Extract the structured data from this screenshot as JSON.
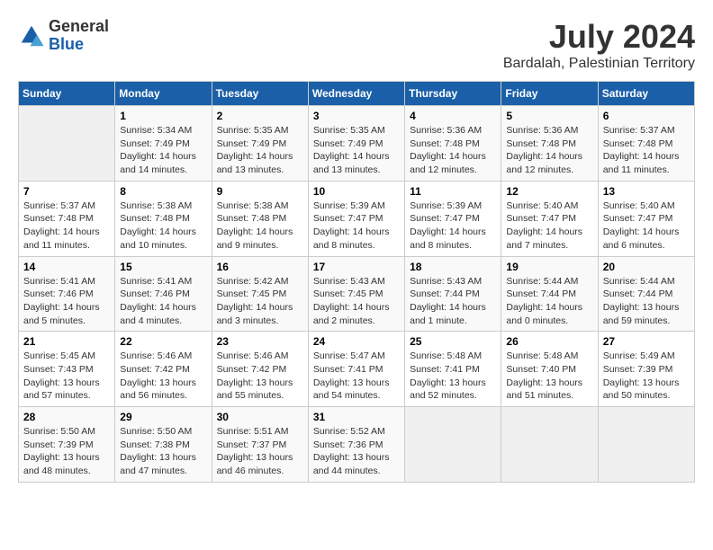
{
  "header": {
    "logo_general": "General",
    "logo_blue": "Blue",
    "month_year": "July 2024",
    "location": "Bardalah, Palestinian Territory"
  },
  "days_of_week": [
    "Sunday",
    "Monday",
    "Tuesday",
    "Wednesday",
    "Thursday",
    "Friday",
    "Saturday"
  ],
  "weeks": [
    [
      {
        "day": "",
        "info": ""
      },
      {
        "day": "1",
        "info": "Sunrise: 5:34 AM\nSunset: 7:49 PM\nDaylight: 14 hours\nand 14 minutes."
      },
      {
        "day": "2",
        "info": "Sunrise: 5:35 AM\nSunset: 7:49 PM\nDaylight: 14 hours\nand 13 minutes."
      },
      {
        "day": "3",
        "info": "Sunrise: 5:35 AM\nSunset: 7:49 PM\nDaylight: 14 hours\nand 13 minutes."
      },
      {
        "day": "4",
        "info": "Sunrise: 5:36 AM\nSunset: 7:48 PM\nDaylight: 14 hours\nand 12 minutes."
      },
      {
        "day": "5",
        "info": "Sunrise: 5:36 AM\nSunset: 7:48 PM\nDaylight: 14 hours\nand 12 minutes."
      },
      {
        "day": "6",
        "info": "Sunrise: 5:37 AM\nSunset: 7:48 PM\nDaylight: 14 hours\nand 11 minutes."
      }
    ],
    [
      {
        "day": "7",
        "info": "Sunrise: 5:37 AM\nSunset: 7:48 PM\nDaylight: 14 hours\nand 11 minutes."
      },
      {
        "day": "8",
        "info": "Sunrise: 5:38 AM\nSunset: 7:48 PM\nDaylight: 14 hours\nand 10 minutes."
      },
      {
        "day": "9",
        "info": "Sunrise: 5:38 AM\nSunset: 7:48 PM\nDaylight: 14 hours\nand 9 minutes."
      },
      {
        "day": "10",
        "info": "Sunrise: 5:39 AM\nSunset: 7:47 PM\nDaylight: 14 hours\nand 8 minutes."
      },
      {
        "day": "11",
        "info": "Sunrise: 5:39 AM\nSunset: 7:47 PM\nDaylight: 14 hours\nand 8 minutes."
      },
      {
        "day": "12",
        "info": "Sunrise: 5:40 AM\nSunset: 7:47 PM\nDaylight: 14 hours\nand 7 minutes."
      },
      {
        "day": "13",
        "info": "Sunrise: 5:40 AM\nSunset: 7:47 PM\nDaylight: 14 hours\nand 6 minutes."
      }
    ],
    [
      {
        "day": "14",
        "info": "Sunrise: 5:41 AM\nSunset: 7:46 PM\nDaylight: 14 hours\nand 5 minutes."
      },
      {
        "day": "15",
        "info": "Sunrise: 5:41 AM\nSunset: 7:46 PM\nDaylight: 14 hours\nand 4 minutes."
      },
      {
        "day": "16",
        "info": "Sunrise: 5:42 AM\nSunset: 7:45 PM\nDaylight: 14 hours\nand 3 minutes."
      },
      {
        "day": "17",
        "info": "Sunrise: 5:43 AM\nSunset: 7:45 PM\nDaylight: 14 hours\nand 2 minutes."
      },
      {
        "day": "18",
        "info": "Sunrise: 5:43 AM\nSunset: 7:44 PM\nDaylight: 14 hours\nand 1 minute."
      },
      {
        "day": "19",
        "info": "Sunrise: 5:44 AM\nSunset: 7:44 PM\nDaylight: 14 hours\nand 0 minutes."
      },
      {
        "day": "20",
        "info": "Sunrise: 5:44 AM\nSunset: 7:44 PM\nDaylight: 13 hours\nand 59 minutes."
      }
    ],
    [
      {
        "day": "21",
        "info": "Sunrise: 5:45 AM\nSunset: 7:43 PM\nDaylight: 13 hours\nand 57 minutes."
      },
      {
        "day": "22",
        "info": "Sunrise: 5:46 AM\nSunset: 7:42 PM\nDaylight: 13 hours\nand 56 minutes."
      },
      {
        "day": "23",
        "info": "Sunrise: 5:46 AM\nSunset: 7:42 PM\nDaylight: 13 hours\nand 55 minutes."
      },
      {
        "day": "24",
        "info": "Sunrise: 5:47 AM\nSunset: 7:41 PM\nDaylight: 13 hours\nand 54 minutes."
      },
      {
        "day": "25",
        "info": "Sunrise: 5:48 AM\nSunset: 7:41 PM\nDaylight: 13 hours\nand 52 minutes."
      },
      {
        "day": "26",
        "info": "Sunrise: 5:48 AM\nSunset: 7:40 PM\nDaylight: 13 hours\nand 51 minutes."
      },
      {
        "day": "27",
        "info": "Sunrise: 5:49 AM\nSunset: 7:39 PM\nDaylight: 13 hours\nand 50 minutes."
      }
    ],
    [
      {
        "day": "28",
        "info": "Sunrise: 5:50 AM\nSunset: 7:39 PM\nDaylight: 13 hours\nand 48 minutes."
      },
      {
        "day": "29",
        "info": "Sunrise: 5:50 AM\nSunset: 7:38 PM\nDaylight: 13 hours\nand 47 minutes."
      },
      {
        "day": "30",
        "info": "Sunrise: 5:51 AM\nSunset: 7:37 PM\nDaylight: 13 hours\nand 46 minutes."
      },
      {
        "day": "31",
        "info": "Sunrise: 5:52 AM\nSunset: 7:36 PM\nDaylight: 13 hours\nand 44 minutes."
      },
      {
        "day": "",
        "info": ""
      },
      {
        "day": "",
        "info": ""
      },
      {
        "day": "",
        "info": ""
      }
    ]
  ]
}
